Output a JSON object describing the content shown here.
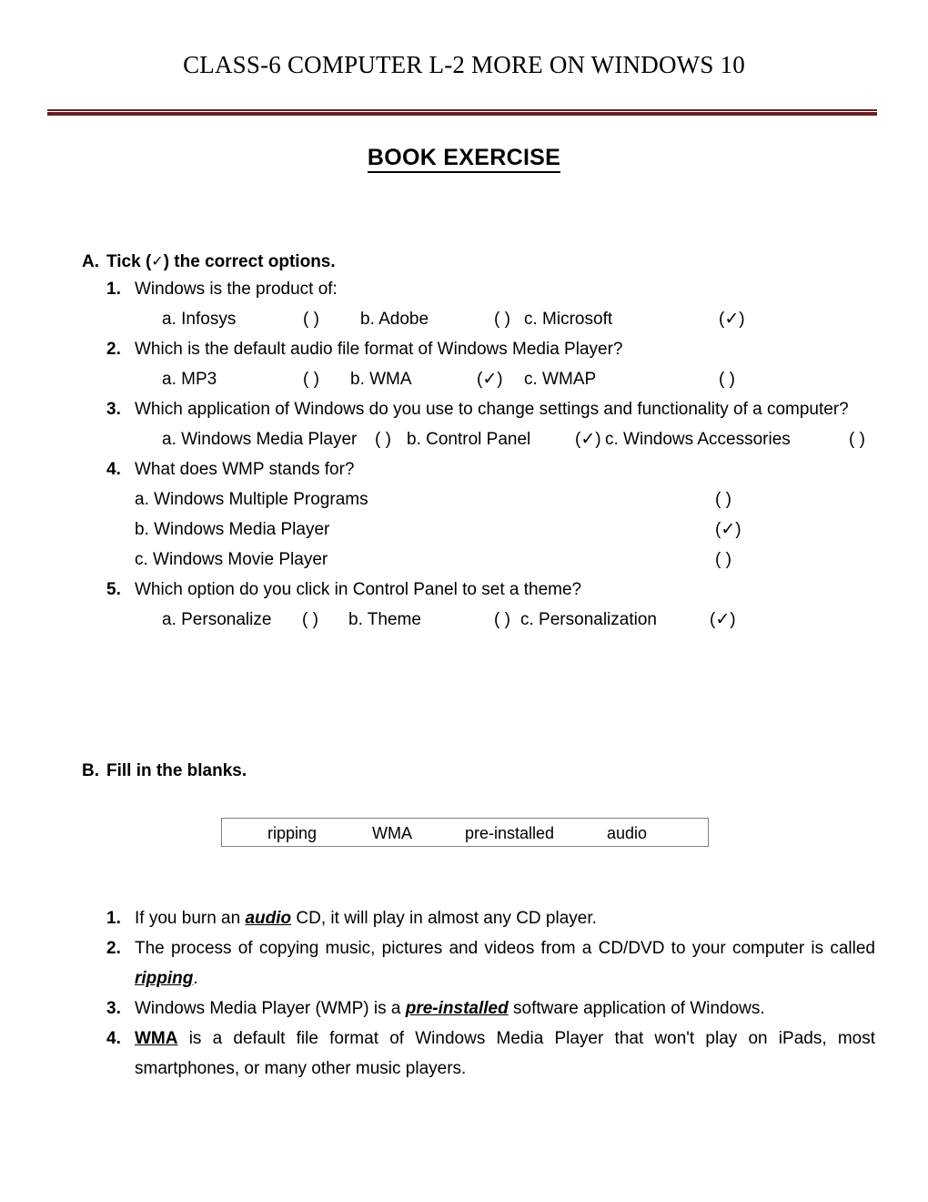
{
  "header": {
    "title": "CLASS-6 COMPUTER L-2 MORE ON WINDOWS 10",
    "rule_color": "#6b2020"
  },
  "page_heading": "BOOK EXERCISE",
  "section_a": {
    "letter": "A.",
    "heading_prefix": "Tick (",
    "heading_tick": "✓",
    "heading_suffix": ") the correct options.",
    "questions": [
      {
        "num": "1.",
        "text": "Windows is the product of:",
        "layout": "inline",
        "options": [
          {
            "label": "a.  Infosys",
            "marker": "( )",
            "ticked": false
          },
          {
            "label": "b. Adobe",
            "marker": "( )",
            "ticked": false
          },
          {
            "label": "c. Microsoft",
            "marker": "(✓)",
            "ticked": true
          }
        ]
      },
      {
        "num": "2.",
        "text": "Which is the default audio file format of Windows Media Player?",
        "layout": "inline",
        "options": [
          {
            "label": "a.  MP3",
            "marker": "( )",
            "ticked": false
          },
          {
            "label": "b. WMA",
            "marker": "(✓)",
            "ticked": true
          },
          {
            "label": "c. WMAP",
            "marker": "( )",
            "ticked": false
          }
        ]
      },
      {
        "num": "3.",
        "text": "Which application of Windows do you use to change settings and functionality of a computer?",
        "layout": "inline",
        "options": [
          {
            "label": "a.  Windows Media Player",
            "marker": "( )",
            "ticked": false
          },
          {
            "label": "b. Control Panel",
            "marker": "(✓)",
            "ticked": true
          },
          {
            "label": "c. Windows Accessories",
            "marker": "( )",
            "ticked": false
          }
        ]
      },
      {
        "num": "4.",
        "text": "What does WMP stands for?",
        "layout": "stacked",
        "options": [
          {
            "label": "a.  Windows Multiple Programs",
            "marker": "( )",
            "ticked": false
          },
          {
            "label": "b.  Windows Media Player",
            "marker": "(✓)",
            "ticked": true
          },
          {
            "label": "c.  Windows Movie Player",
            "marker": "( )",
            "ticked": false
          }
        ]
      },
      {
        "num": "5.",
        "text": "Which option do you click in Control Panel to set a theme?",
        "layout": "inline",
        "options": [
          {
            "label": "a.  Personalize",
            "marker": "( )",
            "ticked": false
          },
          {
            "label": "b. Theme",
            "marker": "( )",
            "ticked": false
          },
          {
            "label": "c. Personalization",
            "marker": "(✓)",
            "ticked": true
          }
        ]
      }
    ]
  },
  "section_b": {
    "letter": "B.",
    "heading": "Fill in the blanks.",
    "word_bank": [
      "ripping",
      "WMA",
      "pre-installed",
      "audio"
    ],
    "items": [
      {
        "num": "1.",
        "before": "If you burn an ",
        "answer": "audio",
        "after": " CD, it will play in almost any CD player.",
        "answer_style": "italic",
        "justify": false
      },
      {
        "num": "2.",
        "before": "The process of copying music, pictures and videos from a CD/DVD to your computer is called ",
        "answer": "ripping",
        "after": ".",
        "answer_style": "italic",
        "justify": true
      },
      {
        "num": "3.",
        "before": " Windows Media Player (WMP) is a ",
        "answer": "pre-installed",
        "after": " software application of Windows.",
        "answer_style": "italic",
        "justify": false
      },
      {
        "num": "4.",
        "before": "",
        "answer": "WMA",
        "after": " is a default file format of Windows Media Player that won't play on iPads, most smartphones, or many other music players.",
        "answer_style": "upright",
        "justify": true
      }
    ]
  }
}
